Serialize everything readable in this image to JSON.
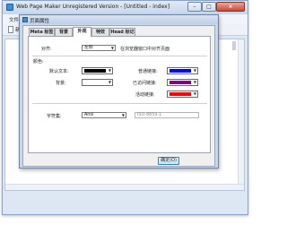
{
  "app": {
    "title": "Web Page Maker Unregistered Version - [Untitled - index]",
    "menu_first": "文件(F)",
    "toolbar_first": "新",
    "buttons": {
      "minimize": "–",
      "maximize": "□",
      "close": "×"
    }
  },
  "dialog": {
    "title": "页面属性",
    "tabs": [
      {
        "label": "Meta 标签",
        "active": false
      },
      {
        "label": "背景",
        "active": false
      },
      {
        "label": "外观",
        "active": true
      },
      {
        "label": "特效",
        "active": false
      },
      {
        "label": "Head 标记",
        "active": false
      }
    ],
    "align": {
      "label": "对齐:",
      "value": "左侧",
      "hint": "在浏览器窗口中对齐页面"
    },
    "colors_group": "颜色:",
    "default_text": {
      "label": "默认文本:",
      "color": "#000000"
    },
    "background": {
      "label": "背景:",
      "color": "#ffffff"
    },
    "link": {
      "label": "普通链接:",
      "color": "#0000ff"
    },
    "visited_link": {
      "label": "已访问链接:",
      "color": "#800080"
    },
    "active_link": {
      "label": "活动链接:",
      "color": "#ff0000"
    },
    "charset": {
      "label": "字符集:",
      "value": "Ansi",
      "encoding": "ISO-8859-1"
    },
    "ok_label": "确定(O)"
  }
}
